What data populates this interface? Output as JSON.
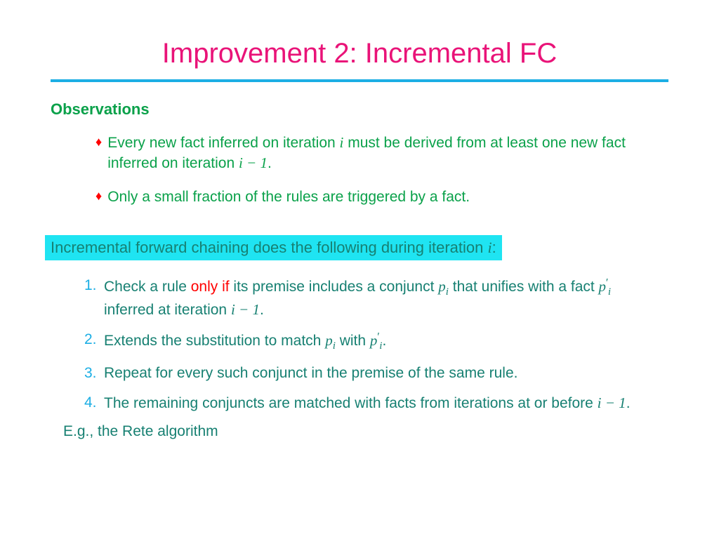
{
  "title": "Improvement 2: Incremental FC",
  "sectionHead": "Observations",
  "obs1_a": "Every new fact inferred on iteration ",
  "obs1_b": " must be derived from at least one new fact inferred on iteration ",
  "obs1_c": ".",
  "obs2": "Only a small fraction of the rules are triggered by a fact.",
  "hl_a": "Incremental forward chaining does the following during iteration ",
  "hl_b": ":",
  "n1_a": "Check a rule ",
  "n1_only": "only if",
  "n1_b": " its premise includes a conjunct ",
  "n1_c": " that unifies with a fact ",
  "n1_d": " inferred at iteration ",
  "n1_e": ".",
  "n2_a": "Extends the substitution to match ",
  "n2_b": " with ",
  "n2_c": ".",
  "n3": "Repeat for every such conjunct in the premise of the same rule.",
  "n4_a": "The remaining conjuncts are matched with facts from iterations at or before ",
  "n4_b": ".",
  "footer": "E.g., the Rete algorithm",
  "num1": "1.",
  "num2": "2.",
  "num3": "3.",
  "num4": "4.",
  "sym_i": "i",
  "sym_im1": "i − 1",
  "sym_p": "p",
  "sym_prime": "′"
}
